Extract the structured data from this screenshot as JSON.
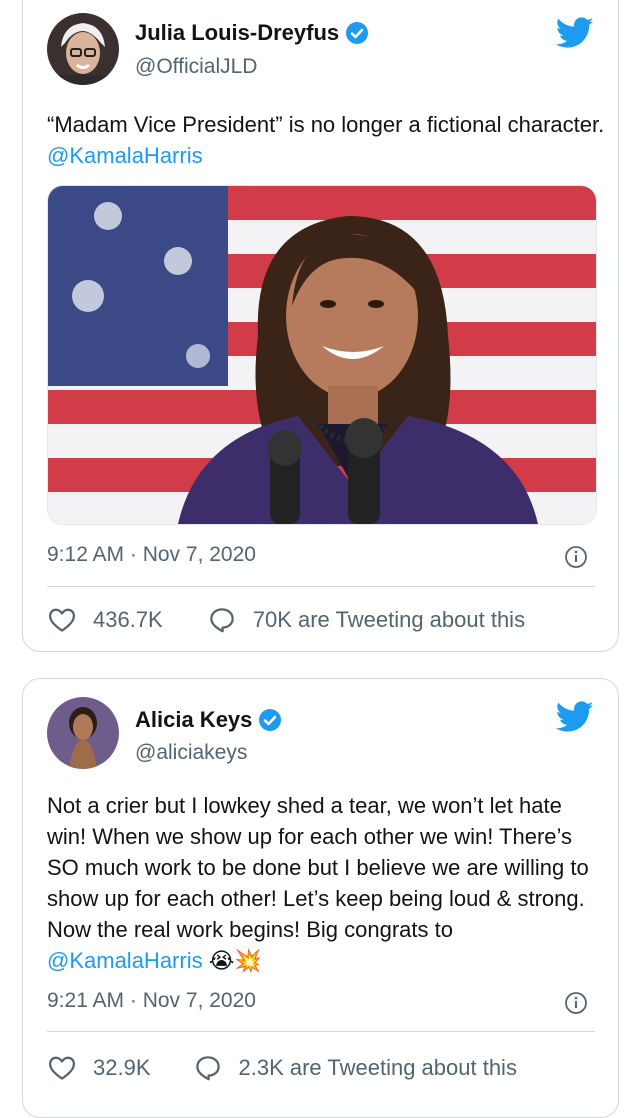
{
  "tweets": [
    {
      "name": "Julia Louis-Dreyfus",
      "handle": "@OfficialJLD",
      "text_main": "“Madam Vice President” is no longer a fictional character. ",
      "mention": "@KamalaHarris",
      "timestamp": "9:12 AM · Nov 7, 2020",
      "likes": "436.7K",
      "tweeting": "70K are Tweeting about this",
      "has_photo": true
    },
    {
      "name": "Alicia Keys",
      "handle": "@aliciakeys",
      "text_main": "Not a crier but I lowkey shed a tear, we won’t let hate win! When we show up for each other we win! There’s SO much work to be done but I believe we are willing to show up for each other! Let’s keep being loud & strong. Now the real work begins! Big congrats to ",
      "mention": "@KamalaHarris",
      "emoji": "😭💥",
      "timestamp": "9:21 AM · Nov 7, 2020",
      "likes": "32.9K",
      "tweeting": "2.3K are Tweeting about this"
    }
  ],
  "colors": {
    "accent": "#1d9bf0",
    "secondary_text": "#536471",
    "border": "#cfd9de"
  },
  "icons": [
    "verified-badge-icon",
    "twitter-bird-icon",
    "info-icon",
    "heart-icon",
    "speech-bubble-icon"
  ]
}
